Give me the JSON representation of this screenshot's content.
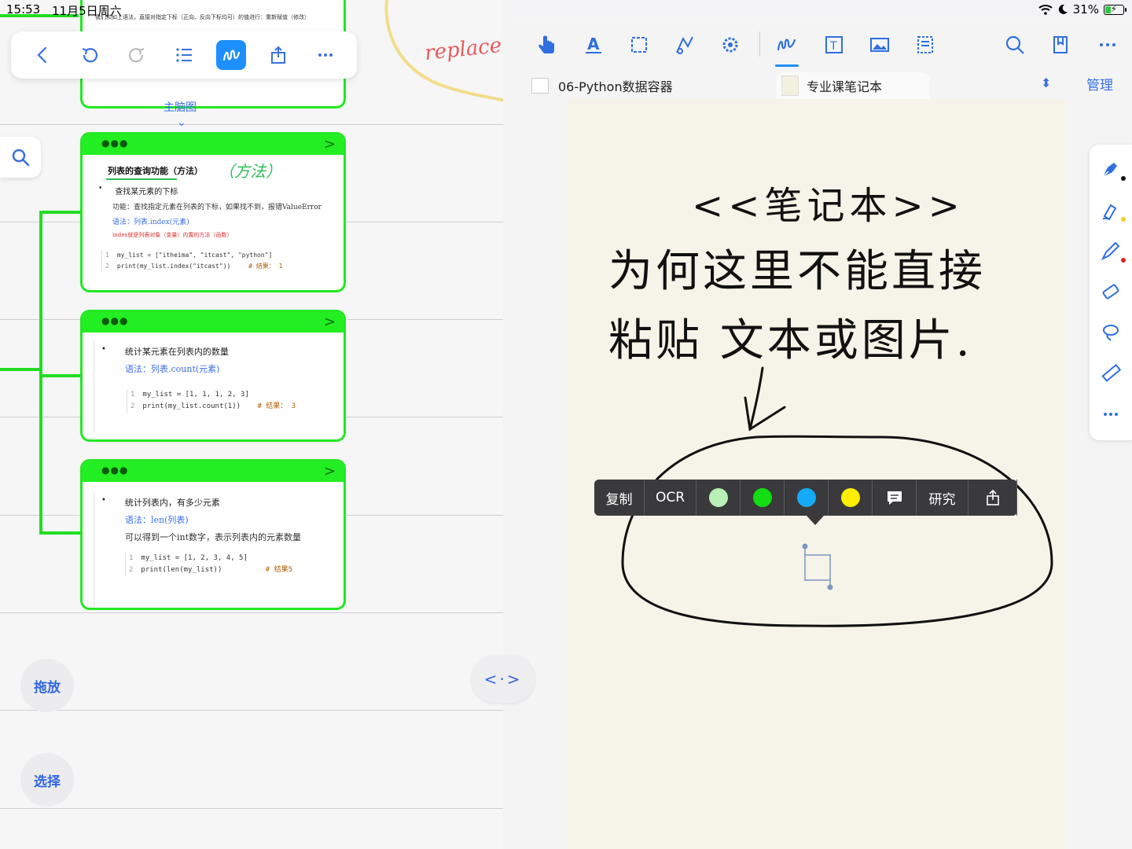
{
  "status": {
    "time": "15:53",
    "date": "11月5日周六",
    "battery_percent": "31%",
    "battery_level": 0.31
  },
  "left_toolbar": {
    "icons": [
      "back-icon",
      "undo-icon",
      "redo-icon",
      "outline-list-icon",
      "handwriting-icon",
      "share-icon",
      "more-icon"
    ],
    "active": "handwriting-icon"
  },
  "mindmap": {
    "label": "主脑图",
    "top_card_snippet": "我们和如上语法，直接对指定下标（正向、反向下标均可）的值进行：重新赋值（修改）",
    "cards": [
      {
        "title": "列表的查询功能（方法）",
        "handwritten_note": "（方法）",
        "bullet": "查找某元素的下标",
        "desc": "功能：查找指定元素在列表的下标，如果找不到，报错ValueError",
        "syntax": "语法：列表.index(元素)",
        "note": "index就是列表对象（变量）内置的方法（函数）",
        "code": [
          {
            "n": "1",
            "code": "my_list = [\"itheima\", \"itcast\", \"python\"]",
            "comment": ""
          },
          {
            "n": "2",
            "code": "print(my_list.index(\"itcast\"))",
            "comment": "# 结果：  1"
          }
        ]
      },
      {
        "bullet": "统计某元素在列表内的数量",
        "syntax": "语法：列表.count(元素)",
        "code": [
          {
            "n": "1",
            "code": "my_list = [1, 1, 1, 2, 3]",
            "comment": ""
          },
          {
            "n": "2",
            "code": "print(my_list.count(1))",
            "comment": "# 结果：  3"
          }
        ]
      },
      {
        "bullet": "统计列表内，有多少元素",
        "syntax": "语法：len(列表)",
        "desc": "可以得到一个int数字，表示列表内的元素数量",
        "code": [
          {
            "n": "1",
            "code": "my_list = [1, 2, 3, 4, 5]",
            "comment": ""
          },
          {
            "n": "2",
            "code": "print(len(my_list))",
            "comment": "# 结果5"
          }
        ]
      }
    ]
  },
  "left_buttons": {
    "drag": "拖放",
    "select": "选择"
  },
  "handwritten_replace": "replace",
  "right_toolbar": {
    "icons": [
      "touch-icon",
      "text-style-icon",
      "crop-icon",
      "shape-icon",
      "settings-icon",
      "pen-icon",
      "textbox-icon",
      "image-icon",
      "template-icon",
      "search-icon",
      "bookmark-icon",
      "more-icon"
    ]
  },
  "tabs": {
    "doc_tab": "06-Python数据容器",
    "notebook_tab": "专业课笔记本",
    "manage": "管理"
  },
  "notebook": {
    "handwriting_lines": [
      "<<笔记本>>",
      "为何这里不能直接",
      "粘贴 文本或图片."
    ]
  },
  "popup": {
    "copy": "复制",
    "ocr": "OCR",
    "research": "研究",
    "swatches": [
      "#b8f0b8",
      "#11dd11",
      "#15aaf5",
      "#ffee00"
    ]
  },
  "side_tools": [
    "fountain-pen-icon",
    "highlighter-icon",
    "pencil-icon",
    "eraser-icon",
    "lasso-icon",
    "ruler-icon",
    "more-icon"
  ]
}
